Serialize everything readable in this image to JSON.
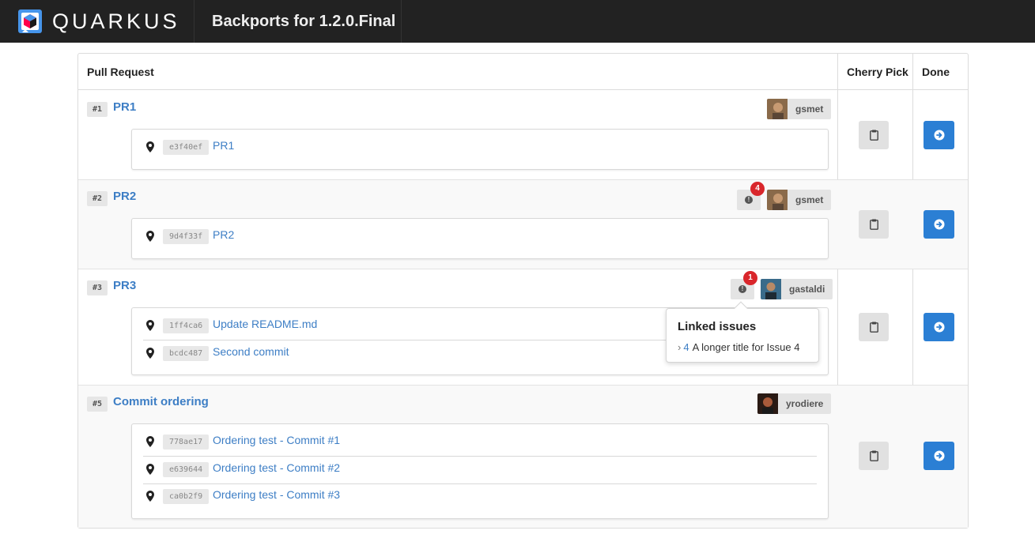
{
  "header": {
    "brand": "QUARKUS",
    "title": "Backports for 1.2.0.Final"
  },
  "table": {
    "columns": [
      "Pull Request",
      "Cherry Pick",
      "Done"
    ]
  },
  "rows": [
    {
      "number": "#1",
      "title": "PR1",
      "author": "gsmet",
      "issue_count": null,
      "commits": [
        {
          "sha": "e3f40ef",
          "message": "PR1"
        }
      ]
    },
    {
      "number": "#2",
      "title": "PR2",
      "author": "gsmet",
      "issue_count": "4",
      "commits": [
        {
          "sha": "9d4f33f",
          "message": "PR2"
        }
      ]
    },
    {
      "number": "#3",
      "title": "PR3",
      "author": "gastaldi",
      "issue_count": "1",
      "commits": [
        {
          "sha": "1ff4ca6",
          "message": "Update README.md"
        },
        {
          "sha": "bcdc487",
          "message": "Second commit"
        }
      ]
    },
    {
      "number": "#5",
      "title": "Commit ordering",
      "author": "yrodiere",
      "issue_count": null,
      "commits": [
        {
          "sha": "778ae17",
          "message": "Ordering test - Commit #1"
        },
        {
          "sha": "e639644",
          "message": "Ordering test - Commit #2"
        },
        {
          "sha": "ca0b2f9",
          "message": "Ordering test - Commit #3"
        }
      ]
    }
  ],
  "popover": {
    "title": "Linked issues",
    "caret": "›",
    "issue_number": "4",
    "issue_title": "A longer title for Issue 4"
  },
  "icons": {
    "pin": "map-marker-icon",
    "cherry_pick": "clipboard-icon",
    "done": "arrow-circle-right-icon",
    "issue": "exclamation-circle-icon"
  },
  "colors": {
    "topbar": "#222222",
    "link": "#3d7ec5",
    "primary": "#2b7fd4",
    "badge": "#d9262b"
  }
}
